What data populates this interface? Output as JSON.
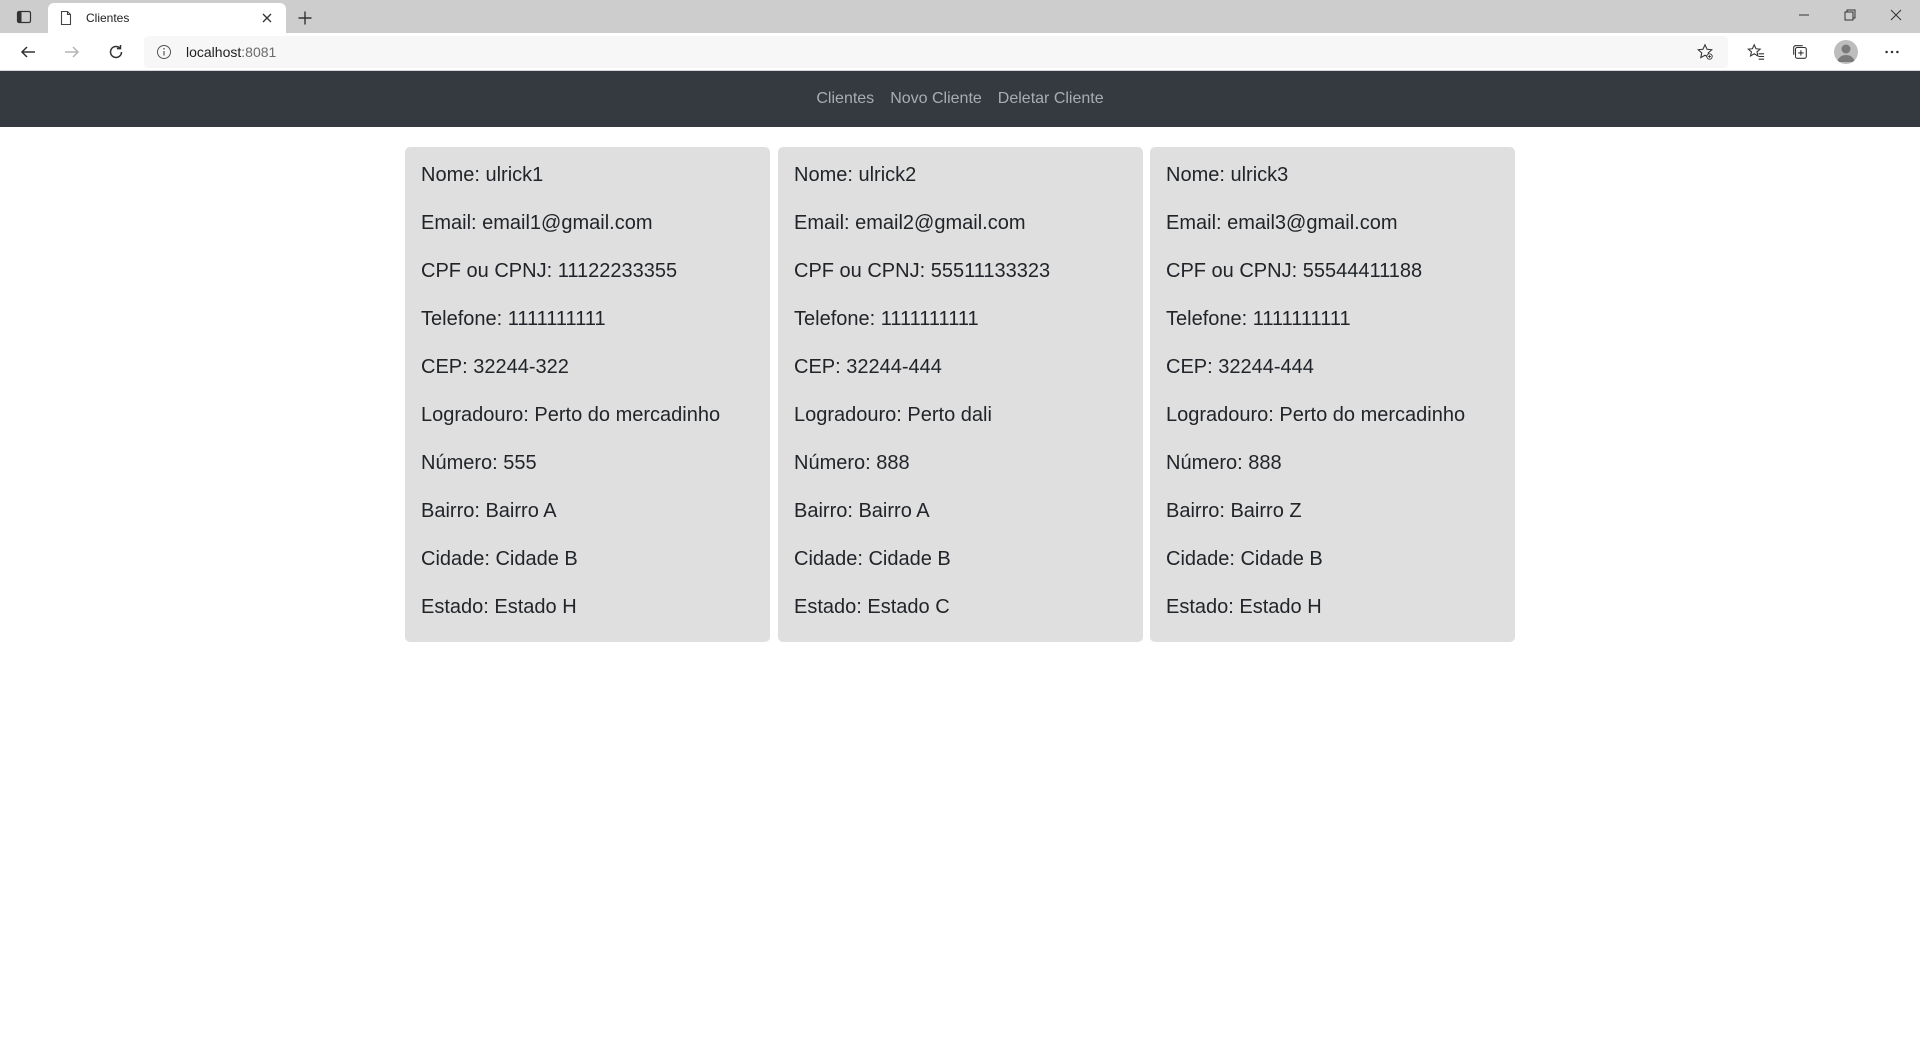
{
  "browser": {
    "tab_title": "Clientes",
    "url_host": "localhost",
    "url_port": ":8081"
  },
  "nav": {
    "links": [
      "Clientes",
      "Novo Cliente",
      "Deletar Cliente"
    ]
  },
  "clientes": [
    {
      "nome": "Nome: ulrick1",
      "email": "Email: email1@gmail.com",
      "cpf": "CPF ou CPNJ: 11122233355",
      "telefone": "Telefone: 1111111111",
      "cep": "CEP: 32244-322",
      "logradouro": "Logradouro: Perto do mercadinho",
      "numero": "Número: 555",
      "bairro": "Bairro: Bairro A",
      "cidade": "Cidade: Cidade B",
      "estado": "Estado: Estado H"
    },
    {
      "nome": "Nome: ulrick2",
      "email": "Email: email2@gmail.com",
      "cpf": "CPF ou CPNJ: 55511133323",
      "telefone": "Telefone: 1111111111",
      "cep": "CEP: 32244-444",
      "logradouro": "Logradouro: Perto dali",
      "numero": "Número: 888",
      "bairro": "Bairro: Bairro A",
      "cidade": "Cidade: Cidade B",
      "estado": "Estado: Estado C"
    },
    {
      "nome": "Nome: ulrick3",
      "email": "Email: email3@gmail.com",
      "cpf": "CPF ou CPNJ: 55544411188",
      "telefone": "Telefone: 1111111111",
      "cep": "CEP: 32244-444",
      "logradouro": "Logradouro: Perto do mercadinho",
      "numero": "Número: 888",
      "bairro": "Bairro: Bairro Z",
      "cidade": "Cidade: Cidade B",
      "estado": "Estado: Estado H"
    }
  ],
  "colors": {
    "navbar": "#343a40",
    "nav_link": "#a8adb2",
    "card_bg": "#dfdfdf",
    "text": "#212529"
  }
}
